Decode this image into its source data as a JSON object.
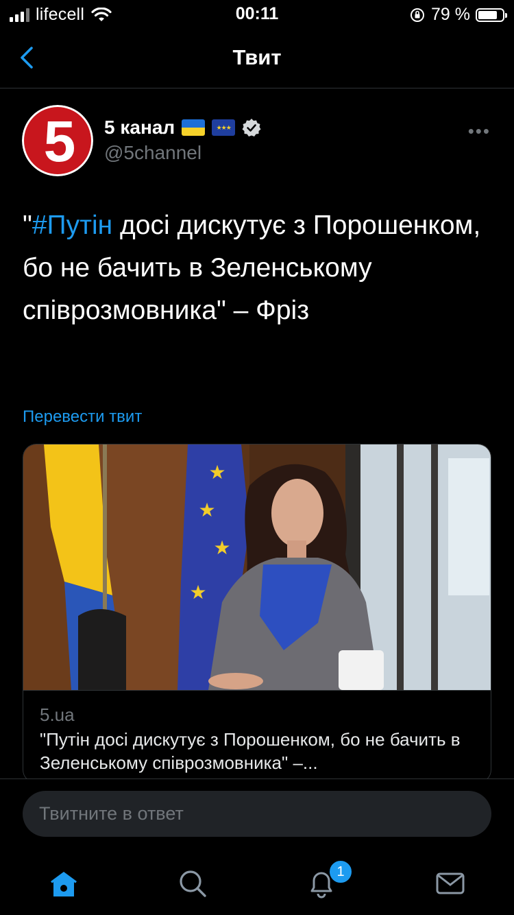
{
  "status_bar": {
    "carrier": "lifecell",
    "time": "00:11",
    "battery_percent": "79 %",
    "battery_level": 0.79,
    "signal_bars": 3
  },
  "nav": {
    "title": "Твит",
    "back_icon": "chevron-left-icon"
  },
  "tweet": {
    "author_name": "5 канал",
    "author_flags": [
      "🇺🇦",
      "🇪🇺"
    ],
    "handle": "@5channel",
    "avatar_text": "5",
    "verified": true,
    "more_label": "•••",
    "text_quote_open": "\"",
    "hashtag": "#Путін",
    "text_body": " досі дискутує з Порошенком, бо не бачить в Зеленському співрозмовника\" – Фріз",
    "translate_label": "Перевести твит"
  },
  "link_card": {
    "domain": "5.ua",
    "title": "\"Путін досі дискутує з Порошенком, бо не бачить в Зеленському співрозмовника\" –..."
  },
  "reply": {
    "placeholder": "Твитните в ответ"
  },
  "tabbar": {
    "items": [
      {
        "icon": "home-icon",
        "active": true
      },
      {
        "icon": "search-icon",
        "active": false
      },
      {
        "icon": "bell-icon",
        "active": false
      },
      {
        "icon": "mail-icon",
        "active": false
      }
    ],
    "notification_count": "1"
  },
  "colors": {
    "background": "#000000",
    "accent": "#1d9bf0",
    "secondary_text": "#71767b",
    "avatar_red": "#c8161d"
  }
}
